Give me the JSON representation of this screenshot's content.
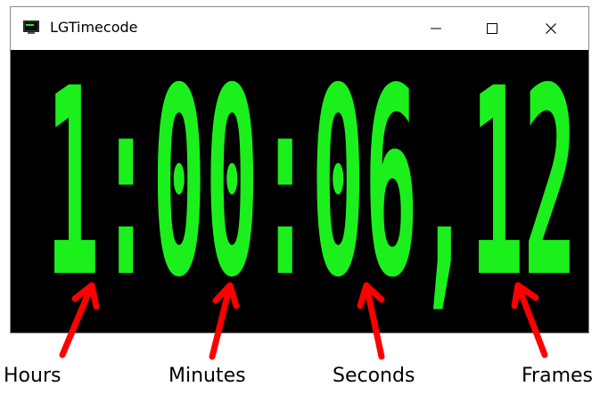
{
  "window": {
    "title": "LGTimecode",
    "app_icon": "monitor-icon",
    "controls": {
      "minimize_icon": "minimize-icon",
      "maximize_icon": "maximize-icon",
      "close_icon": "close-icon"
    }
  },
  "timecode": {
    "display": "1:00:06,12",
    "hours": "1",
    "minutes": "00",
    "seconds": "06",
    "frames": "12",
    "color": "#1cf01c",
    "background": "#000000"
  },
  "annotations": {
    "arrow_color": "#ff0000",
    "labels": {
      "hours": "Hours",
      "minutes": "Minutes",
      "seconds": "Seconds",
      "frames": "Frames"
    }
  }
}
